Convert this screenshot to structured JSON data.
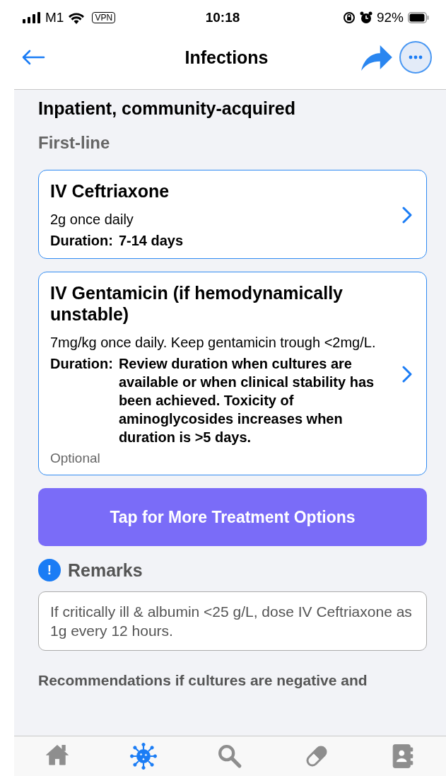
{
  "status_bar": {
    "carrier": "M1",
    "vpn": "VPN",
    "time": "10:18",
    "battery": "92%"
  },
  "nav": {
    "title": "Infections"
  },
  "section": {
    "title": "Inpatient, community-acquired",
    "subtitle": "First-line"
  },
  "treatments": [
    {
      "name": "IV Ceftriaxone",
      "dose": "2g once daily",
      "duration_label": "Duration:",
      "duration": "7-14 days"
    },
    {
      "name": "IV Gentamicin (if hemodynamically unstable)",
      "dose": "7mg/kg once daily. Keep gentamicin trough <2mg/L.",
      "duration_label": "Duration:",
      "duration": "Review duration when cultures are available or when clinical stability has been achieved. Toxicity of aminoglycosides increases when duration is >5 days.",
      "note": "Optional"
    }
  ],
  "more_button": "Tap for More Treatment Options",
  "remarks": {
    "title": "Remarks",
    "badge": "!",
    "text": "If critically ill & albumin <25 g/L, dose IV Ceftriaxone as 1g every 12 hours."
  },
  "recommendations_heading": "Recommendations if cultures are negative and",
  "tab_bar": [
    {
      "kind": "home",
      "selected": false
    },
    {
      "kind": "virus",
      "selected": true
    },
    {
      "kind": "search",
      "selected": false
    },
    {
      "kind": "pill",
      "selected": false
    },
    {
      "kind": "contacts",
      "selected": false
    }
  ]
}
